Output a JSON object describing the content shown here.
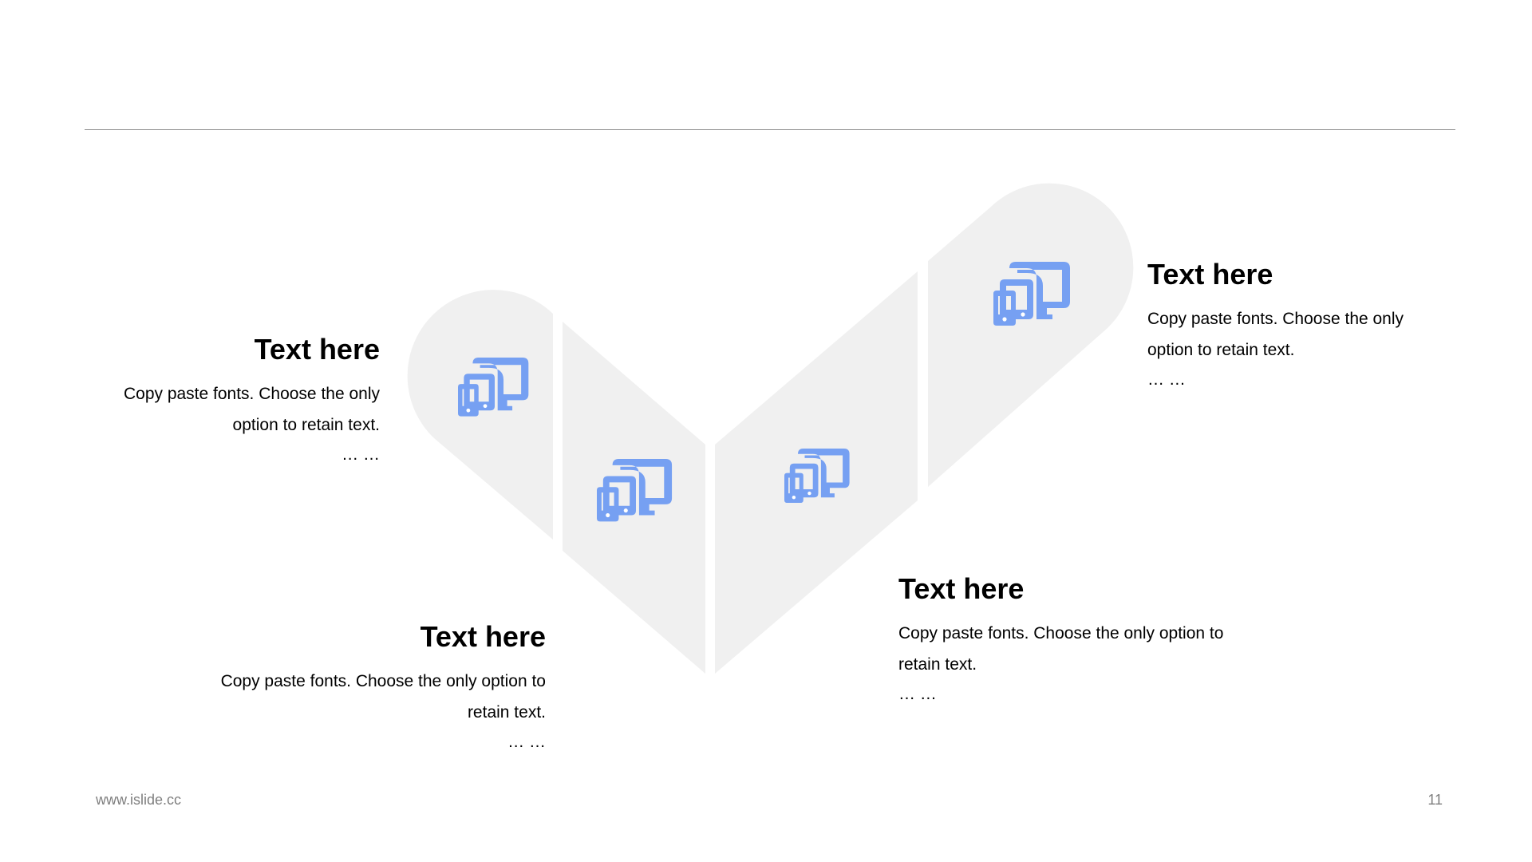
{
  "slide": {
    "footer_url": "www.islide.cc",
    "page_number": "11"
  },
  "colors": {
    "shape_fill": "#f0f0f0",
    "icon": "#76a0f2",
    "rule": "#8c8c8c",
    "footer_text": "#7f7f7f"
  },
  "icons": [
    "devices-icon",
    "devices-icon",
    "devices-icon",
    "devices-icon"
  ],
  "blocks": [
    {
      "title": "Text here",
      "body_lines": [
        "Copy paste fonts. Choose the only",
        "option to retain text."
      ],
      "ellipsis": "… …"
    },
    {
      "title": "Text here",
      "body_lines": [
        "Copy paste fonts. Choose the only option to",
        "retain text."
      ],
      "ellipsis": "… …"
    },
    {
      "title": "Text here",
      "body_lines": [
        "Copy paste fonts. Choose the only option to",
        "retain text."
      ],
      "ellipsis": "… …"
    },
    {
      "title": "Text here",
      "body_lines": [
        "Copy paste fonts. Choose the only",
        "option to retain text."
      ],
      "ellipsis": "… …"
    }
  ]
}
